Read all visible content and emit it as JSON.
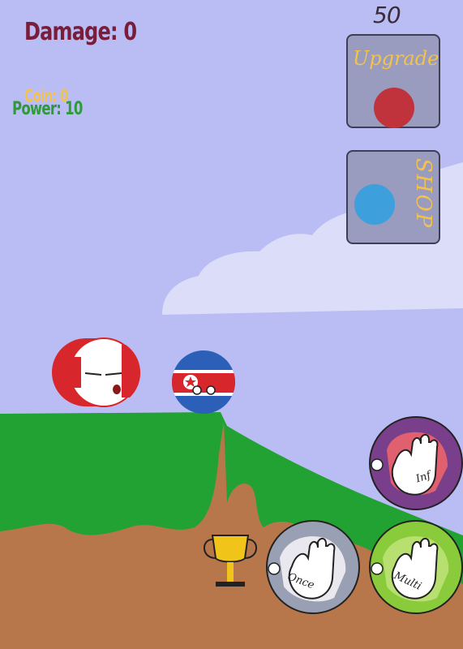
{
  "hud": {
    "damage_text": "Damage: 0",
    "coin_text": "Coin: 0",
    "power_text": "Power: 10"
  },
  "upgrade": {
    "cost": "50",
    "label": "Upgrade"
  },
  "shop": {
    "label": "SHOP"
  },
  "abilities": {
    "inf_label": "Inf",
    "once_label": "Once",
    "multi_label": "Multi"
  },
  "colors": {
    "sky": "#b9bdf3",
    "grass": "#22a232",
    "dirt": "#b8774a",
    "cloud": "#dcddf8",
    "upgrade_dot": "#c0333c",
    "shop_dot": "#3d9fdc",
    "inf_bg": "#7a3f8a",
    "once_bg": "#9aa0b3",
    "multi_bg": "#8acb3c"
  },
  "characters": [
    "peru-ball",
    "north-korea-ball"
  ],
  "icons": [
    "trophy-icon",
    "hand-icon"
  ]
}
